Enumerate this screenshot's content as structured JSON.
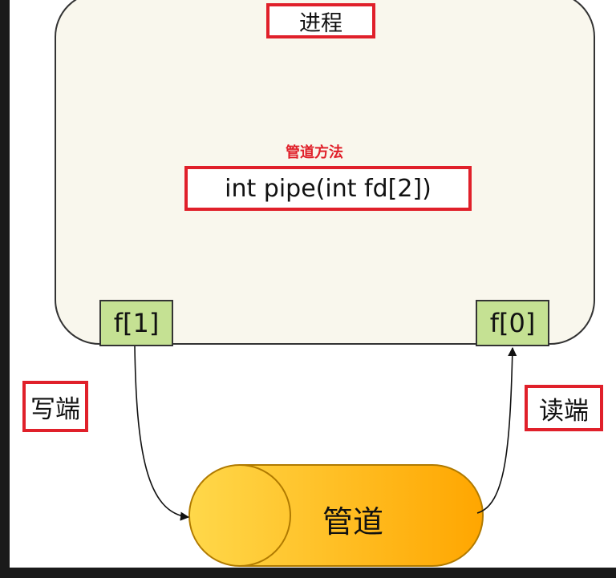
{
  "process": {
    "title": "进程",
    "method_label": "管道方法",
    "code": "int pipe(int fd[2])"
  },
  "fds": {
    "write_fd": "f[1]",
    "read_fd": "f[0]"
  },
  "labels": {
    "write_end": "写端",
    "read_end": "读端",
    "pipe": "管道"
  },
  "colors": {
    "highlight": "#e0202a",
    "process_fill": "#f9f7ed",
    "fd_fill": "#c5e193",
    "pipe_start": "#ffd84a",
    "pipe_end": "#ffa600"
  }
}
